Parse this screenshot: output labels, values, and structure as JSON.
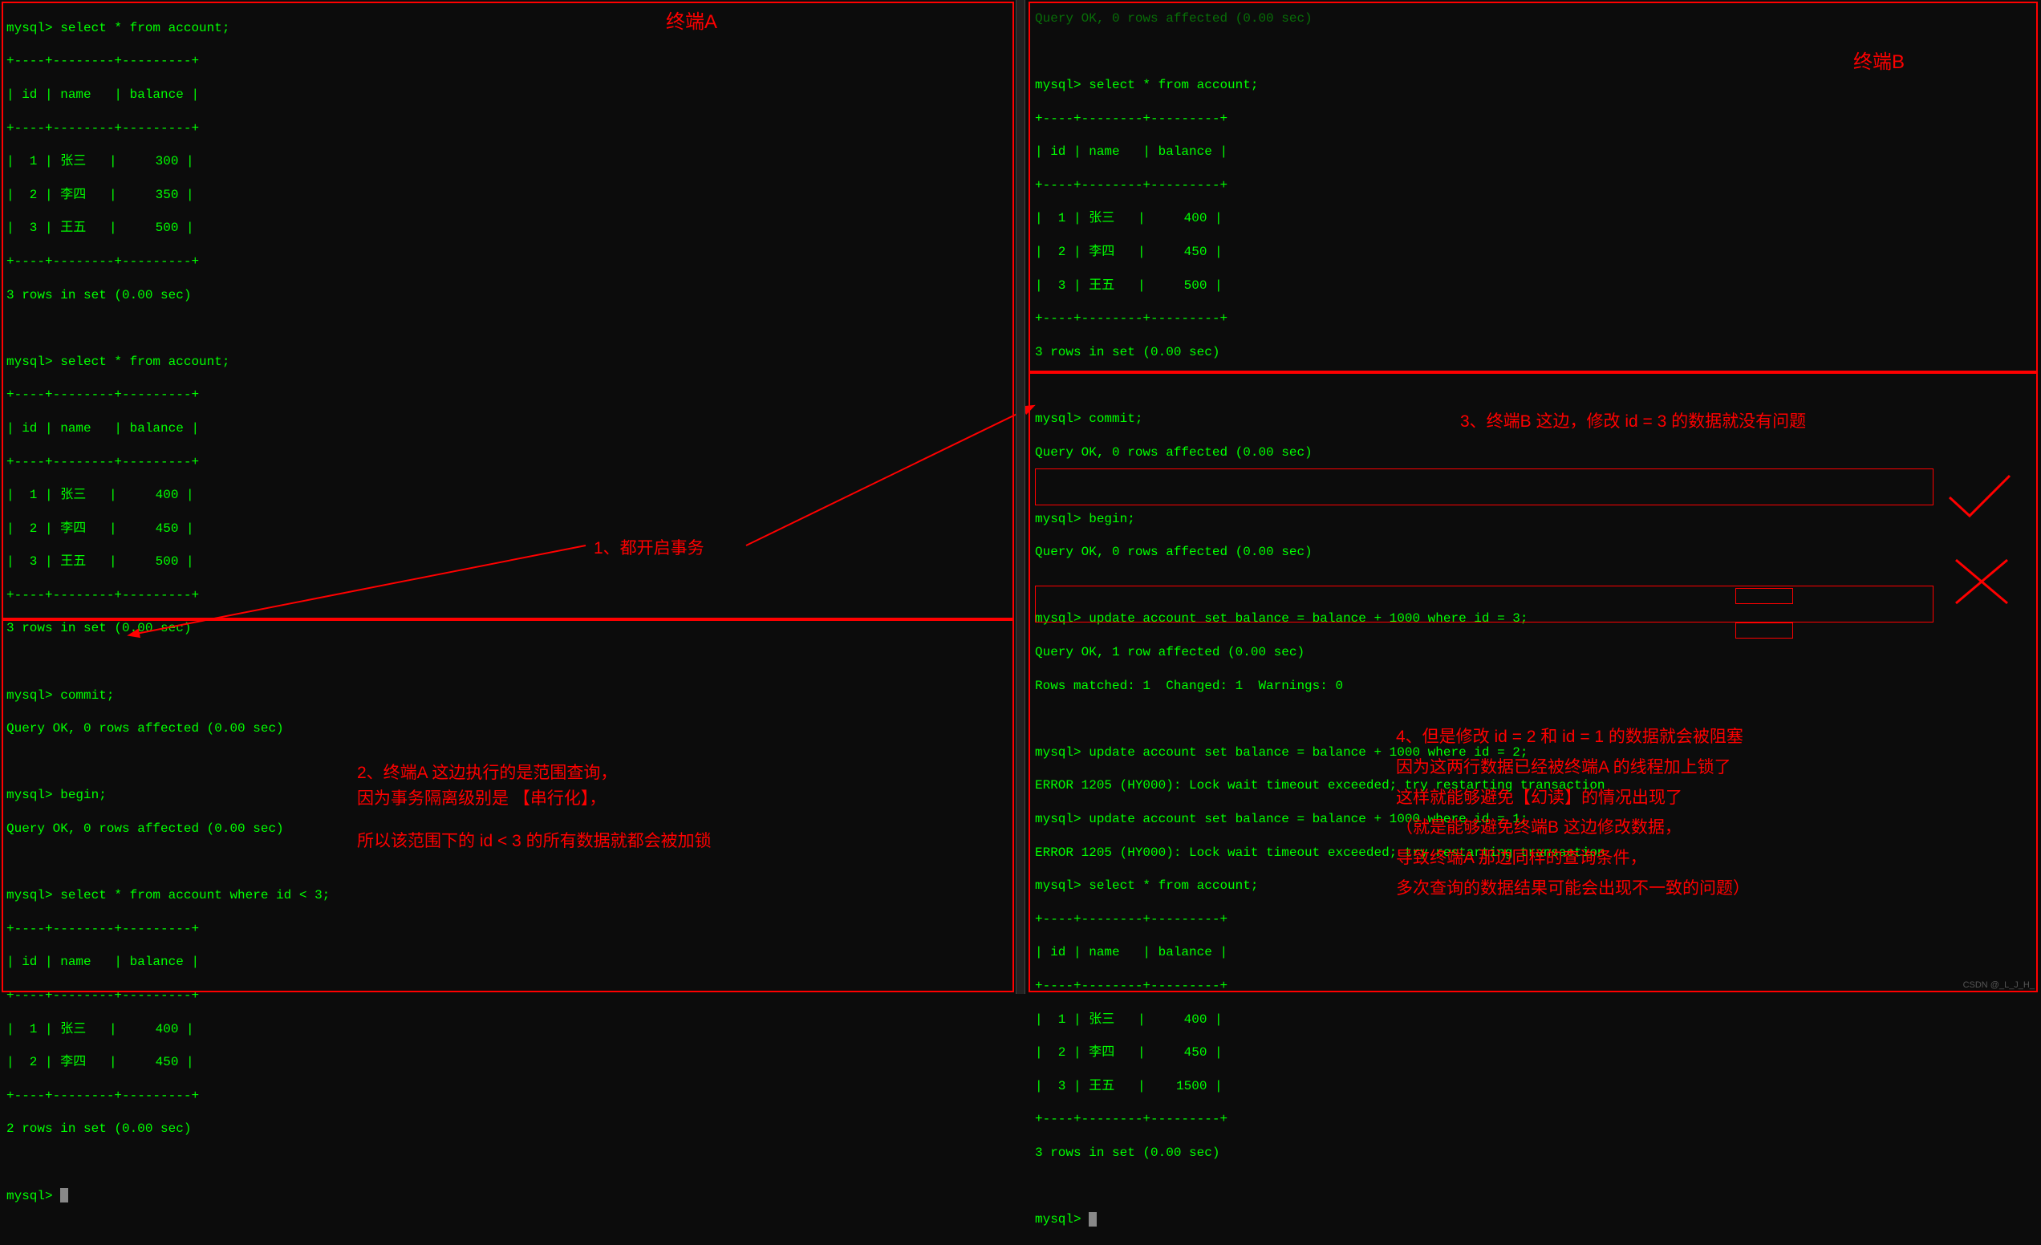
{
  "terminalA": {
    "title": "终端A",
    "line1": "mysql> select * from account;",
    "sep1": "+----+--------+---------+",
    "header1": "| id | name   | balance |",
    "sep2": "+----+--------+---------+",
    "row1_1": "|  1 | 张三   |     300 |",
    "row1_2": "|  2 | 李四   |     350 |",
    "row1_3": "|  3 | 王五   |     500 |",
    "sep3": "+----+--------+---------+",
    "result1": "3 rows in set (0.00 sec)",
    "blank1": "",
    "line2": "mysql> select * from account;",
    "sep4": "+----+--------+---------+",
    "header2": "| id | name   | balance |",
    "sep5": "+----+--------+---------+",
    "row2_1": "|  1 | 张三   |     400 |",
    "row2_2": "|  2 | 李四   |     450 |",
    "row2_3": "|  3 | 王五   |     500 |",
    "sep6": "+----+--------+---------+",
    "result2": "3 rows in set (0.00 sec)",
    "blank2": "",
    "commit1": "mysql> commit;",
    "commit1r": "Query OK, 0 rows affected (0.00 sec)",
    "blank3": "",
    "begin1": "mysql> begin;",
    "begin1r": "Query OK, 0 rows affected (0.00 sec)",
    "blank4": "",
    "line3": "mysql> select * from account where id < 3;",
    "sep7": "+----+--------+---------+",
    "header3": "| id | name   | balance |",
    "sep8": "+----+--------+---------+",
    "row3_1": "|  1 | 张三   |     400 |",
    "row3_2": "|  2 | 李四   |     450 |",
    "sep9": "+----+--------+---------+",
    "result3": "2 rows in set (0.00 sec)",
    "blank5": "",
    "prompt": "mysql> "
  },
  "terminalB": {
    "title": "终端B",
    "truncated": "Query OK, 0 rows affected (0.00 sec)",
    "blank0": "",
    "line1": "mysql> select * from account;",
    "sep1": "+----+--------+---------+",
    "header1": "| id | name   | balance |",
    "sep2": "+----+--------+---------+",
    "row1_1": "|  1 | 张三   |     400 |",
    "row1_2": "|  2 | 李四   |     450 |",
    "row1_3": "|  3 | 王五   |     500 |",
    "sep3": "+----+--------+---------+",
    "result1": "3 rows in set (0.00 sec)",
    "blank1": "",
    "commit1": "mysql> commit;",
    "commit1r": "Query OK, 0 rows affected (0.00 sec)",
    "blank2": "",
    "begin1": "mysql> begin;",
    "begin1r": "Query OK, 0 rows affected (0.00 sec)",
    "blank3": "",
    "upd1": "mysql> update account set balance = balance + 1000 where id = 3;",
    "upd1r": "Query OK, 1 row affected (0.00 sec)",
    "upd1m": "Rows matched: 1  Changed: 1  Warnings: 0",
    "blank4": "",
    "upd2": "mysql> update account set balance = balance + 1000 where id = 2;",
    "err2": "ERROR 1205 (HY000): Lock wait timeout exceeded; try restarting transaction",
    "upd3": "mysql> update account set balance = balance + 1000 where id = 1;",
    "err3": "ERROR 1205 (HY000): Lock wait timeout exceeded; try restarting transaction",
    "line2": "mysql> select * from account;",
    "sep4": "+----+--------+---------+",
    "header2": "| id | name   | balance |",
    "sep5": "+----+--------+---------+",
    "row2_1": "|  1 | 张三   |     400 |",
    "row2_2": "|  2 | 李四   |     450 |",
    "row2_3": "|  3 | 王五   |    1500 |",
    "sep6": "+----+--------+---------+",
    "result2": "3 rows in set (0.00 sec)",
    "blank5": "",
    "prompt": "mysql> "
  },
  "annotations": {
    "note1": "1、都开启事务",
    "note2_l1": "2、终端A 这边执行的是范围查询，",
    "note2_l2": "因为事务隔离级别是 【串行化】，",
    "note2_l3": "所以该范围下的 id < 3 的所有数据就都会被加锁",
    "note3": "3、终端B 这边，修改 id = 3 的数据就没有问题",
    "note4_l1": "4、但是修改 id = 2 和 id = 1 的数据就会被阻塞",
    "note4_l2": "因为这两行数据已经被终端A 的线程加上锁了",
    "note4_l3": "这样就能够避免【幻读】的情况出现了",
    "note4_l4": "（就是能够避免终端B 这边修改数据，",
    "note4_l5": "导致终端A 那边同样的查询条件，",
    "note4_l6": "多次查询的数据结果可能会出现不一致的问题）"
  },
  "watermark": "CSDN @_L_J_H_"
}
